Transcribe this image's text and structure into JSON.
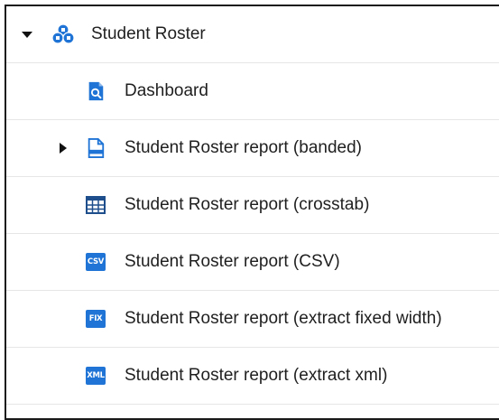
{
  "tree": {
    "root": {
      "label": "Student Roster",
      "icon": "cubes-icon",
      "expanded": true
    },
    "children": [
      {
        "label": "Dashboard",
        "icon": "dashboard-icon",
        "expandable": false
      },
      {
        "label": "Student Roster report (banded)",
        "icon": "report-document-icon",
        "expandable": true,
        "expanded": false
      },
      {
        "label": "Student Roster report (crosstab)",
        "icon": "crosstab-table-icon",
        "expandable": false
      },
      {
        "label": "Student Roster report (CSV)",
        "icon": "csv-icon",
        "badge": "CSV",
        "expandable": false
      },
      {
        "label": "Student Roster report (extract fixed width)",
        "icon": "fixed-width-icon",
        "badge": "FIX",
        "expandable": false
      },
      {
        "label": "Student Roster report (extract xml)",
        "icon": "xml-icon",
        "badge": "XML",
        "expandable": false
      }
    ]
  },
  "colors": {
    "accent": "#1f74d6",
    "text": "#1f1f1f",
    "row_divider": "#e6e6e6",
    "frame_border": "#1a1a1a"
  }
}
